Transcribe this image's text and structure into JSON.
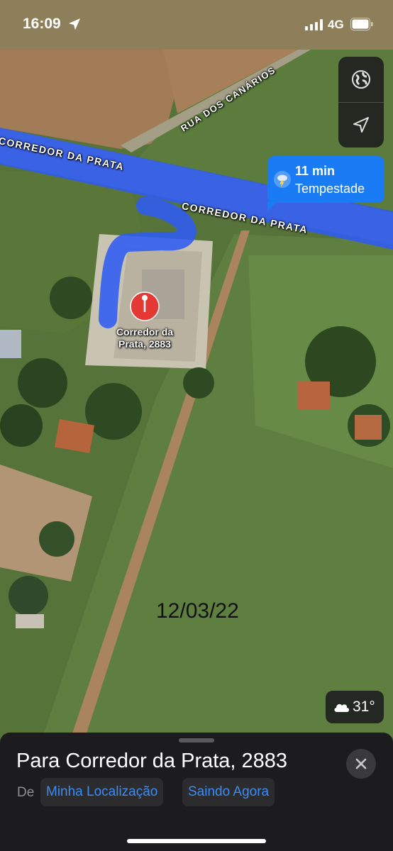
{
  "status_bar": {
    "time": "16:09",
    "network": "4G",
    "icons": [
      "location-arrow-icon",
      "cellular-signal-icon",
      "battery-icon"
    ]
  },
  "map": {
    "roads": {
      "main": "CORREDOR DA PRATA",
      "side": "RUA DOS CANÁRIOS"
    },
    "pin_label_line1": "Corredor da",
    "pin_label_line2": "Prata, 2883",
    "route_color": "#2f5cf2",
    "date_stamp": "12/03/22"
  },
  "controls": {
    "globe_icon": "globe-icon",
    "location_icon": "location-arrow-icon"
  },
  "eta_callout": {
    "time": "11 min",
    "weather": "Tempestade",
    "icon": "thunderstorm-icon"
  },
  "weather_chip": {
    "temperature": "31°",
    "icon": "cloud-icon"
  },
  "sheet": {
    "title": "Para Corredor da Prata, 2883",
    "from_label": "De",
    "from_value": "Minha Localização",
    "departure": "Saindo Agora",
    "close_icon": "close-icon",
    "accent_color": "#3b8cf6"
  }
}
